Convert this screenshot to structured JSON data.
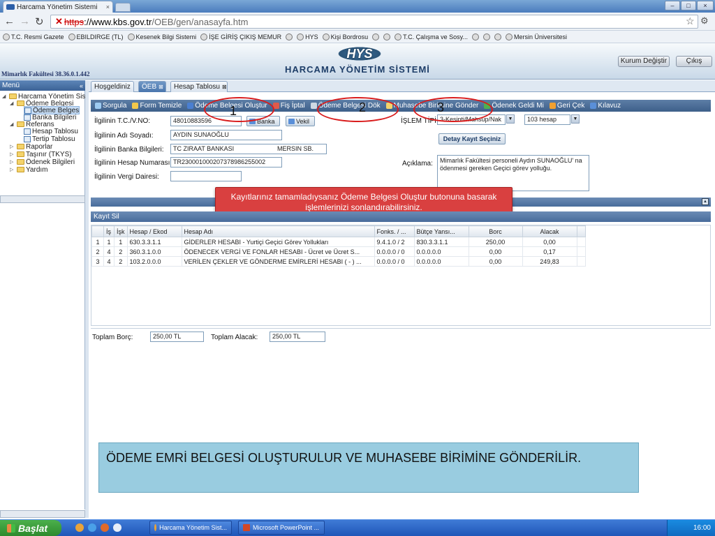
{
  "browser": {
    "tab_title": "Harcama Yönetim Sistemi",
    "url_scheme": "https",
    "url_host": "://www.kbs.gov.tr",
    "url_path": "/OEB/gen/anasayfa.htm",
    "bookmarks": [
      "T.C. Resmi Gazete",
      "EBILDIRGE (TL)",
      "Kesenek Bilgi Sistemi",
      "İŞE GİRİŞ ÇIKIŞ MEMUR",
      "",
      "HYS",
      "Kişi Bordrosu",
      "",
      "",
      "T.C. Çalışma ve Sosy...",
      "",
      "",
      "",
      "Mersin Üniversitesi"
    ]
  },
  "header": {
    "logo": "HYS",
    "system_title": "HARCAMA YÖNETİM SİSTEMİ",
    "ip_text": "Mimarlık Fakültesi 38.36.0.1.442",
    "change_institution": "Kurum Değiştir",
    "logout": "Çıkış"
  },
  "menu": {
    "title": "Menü",
    "items": [
      {
        "label": "Harcama Yönetim Sis"
      },
      {
        "label": "Ödeme Belgesi"
      },
      {
        "label": "Ödeme Belges"
      },
      {
        "label": "Banka Bilgileri"
      },
      {
        "label": "Referans"
      },
      {
        "label": "Hesap Tablosu"
      },
      {
        "label": "Tertip Tablosu"
      },
      {
        "label": "Raporlar"
      },
      {
        "label": "Taşınır (TKYS)"
      },
      {
        "label": "Ödenek Bilgileri"
      },
      {
        "label": "Yardım"
      }
    ]
  },
  "page_tabs": [
    "Hoşgeldiniz",
    "ÖEB",
    "Hesap Tablosu"
  ],
  "toolbar": [
    {
      "label": "Sorgula",
      "color": "#9ecbf2"
    },
    {
      "label": "Form Temizle",
      "color": "#f2c84b"
    },
    {
      "label": "Ödeme Belgesi Oluştur",
      "color": "#4a7fd1"
    },
    {
      "label": "Fiş İptal",
      "color": "#e05a4a"
    },
    {
      "label": "Ödeme Belgesi Dök",
      "color": "#cfd8e3"
    },
    {
      "label": "Muhasebe Birimine Gönder",
      "color": "#f4d36b"
    },
    {
      "label": "Ödenek Geldi Mi",
      "color": "#4fb04f"
    },
    {
      "label": "Geri Çek",
      "color": "#f0a030"
    },
    {
      "label": "Kılavuz",
      "color": "#5a8fd8"
    }
  ],
  "form": {
    "tc_label": "İlgilinin T.C./V.NO:",
    "tc_value": "48010883596",
    "bank_btn": "Banka",
    "vekil_btn": "Vekil",
    "name_label": "İlgilinin Adı Soyadı:",
    "name_value": "AYDIN SUNAOĞLU",
    "bank_label": "İlgilinin Banka Bilgileri:",
    "bank_value": "TC ZIRAAT BANKASI",
    "branch_value": "MERSIN SB.",
    "iban_label": "İlgilinin Hesap Numarası:",
    "iban_value": "TR230001000207378986255002",
    "tax_label": "İlgilinin Vergi Dairesi:",
    "tax_value": "",
    "islem_label": "İŞLEM TİPİ:",
    "islem_value": "3-Kesinti/Mahsup/Nak",
    "hesap_value": "103 hesap",
    "detay_btn": "Detay Kayıt Seçiniz",
    "aciklama_label": "Açıklama:",
    "aciklama_value": "Mimarlık Fakültesi personeli Aydın SUNAOĞLU' na ödenmesi gereken Geçici görev yolluğu."
  },
  "popup_message": "Kayıtlarınız tamamladıysanız Ödeme Belgesi Oluştur butonuna basarak işlemlerinizi sonlandırabilirsiniz.",
  "grid": {
    "title": "Kayıt Sil",
    "columns": [
      "",
      "İş",
      "İşk",
      "Hesap / Ekod",
      "Hesap Adı",
      "Fonks. / ...",
      "Bütçe Yansı...",
      "Borc",
      "Alacak",
      ""
    ],
    "rows": [
      [
        "1",
        "1",
        "1",
        "630.3.3.1.1",
        "GİDERLER HESABI - Yurtiçi Geçici Görev Yollukları",
        "9.4.1.0 / 2",
        "830.3.3.1.1",
        "250,00",
        "0,00",
        ""
      ],
      [
        "2",
        "4",
        "2",
        "360.3.1.0.0",
        "ÖDENECEK VERGİ VE FONLAR HESABI - Ücret ve Ücret S...",
        "0.0.0.0 / 0",
        "0.0.0.0.0",
        "0,00",
        "0,17",
        ""
      ],
      [
        "3",
        "4",
        "2",
        "103.2.0.0.0",
        "VERİLEN ÇEKLER VE GÖNDERME EMİRLERİ HESABI ( - ) ...",
        "0.0.0.0 / 0",
        "0.0.0.0.0",
        "0,00",
        "249,83",
        ""
      ]
    ]
  },
  "totals": {
    "borc_label": "Toplam Borç:",
    "borc_value": "250,00 TL",
    "alacak_label": "Toplam Alacak:",
    "alacak_value": "250,00 TL"
  },
  "annotations": [
    "1",
    "2",
    "3"
  ],
  "caption": "ÖDEME EMRİ BELGESİ OLUŞTURULUR VE MUHASEBE BİRİMİNE GÖNDERİLİR.",
  "taskbar": {
    "start": "Başlat",
    "items": [
      "Harcama Yönetim Sist...",
      "Microsoft PowerPoint ..."
    ],
    "clock": "16:00"
  }
}
